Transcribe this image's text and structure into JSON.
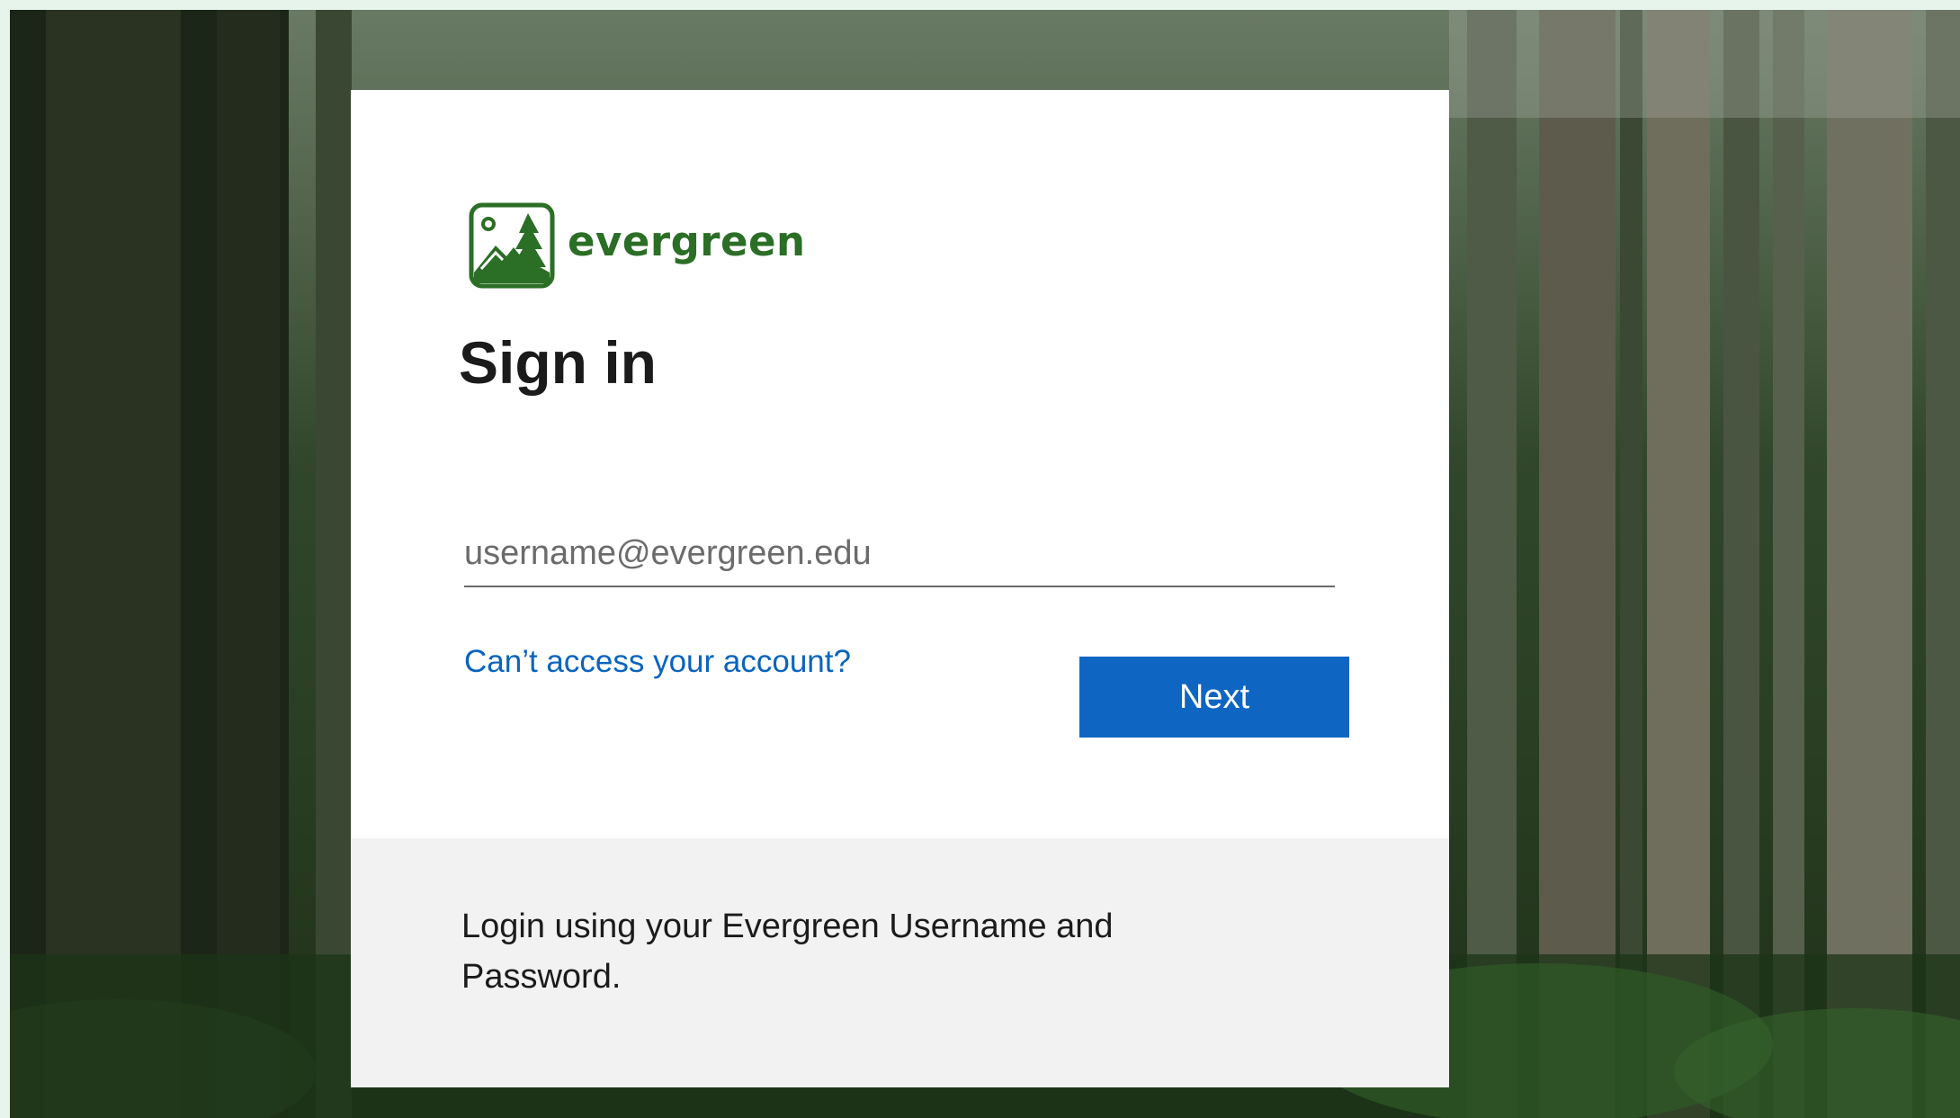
{
  "brand": {
    "name": "evergreen",
    "color": "#2b6e26"
  },
  "form": {
    "title": "Sign in",
    "username_placeholder": "username@evergreen.edu",
    "username_value": "",
    "help_link": "Can’t access your account?",
    "next_label": "Next"
  },
  "footer": {
    "message": "Login using your Evergreen Username and Password."
  },
  "colors": {
    "accent": "#0f66c2",
    "link": "#0a64bd",
    "card": "#ffffff",
    "footer_bg": "#f2f2f2"
  },
  "icons": {
    "logo": "evergreen-tree-mountain-logo-icon"
  }
}
